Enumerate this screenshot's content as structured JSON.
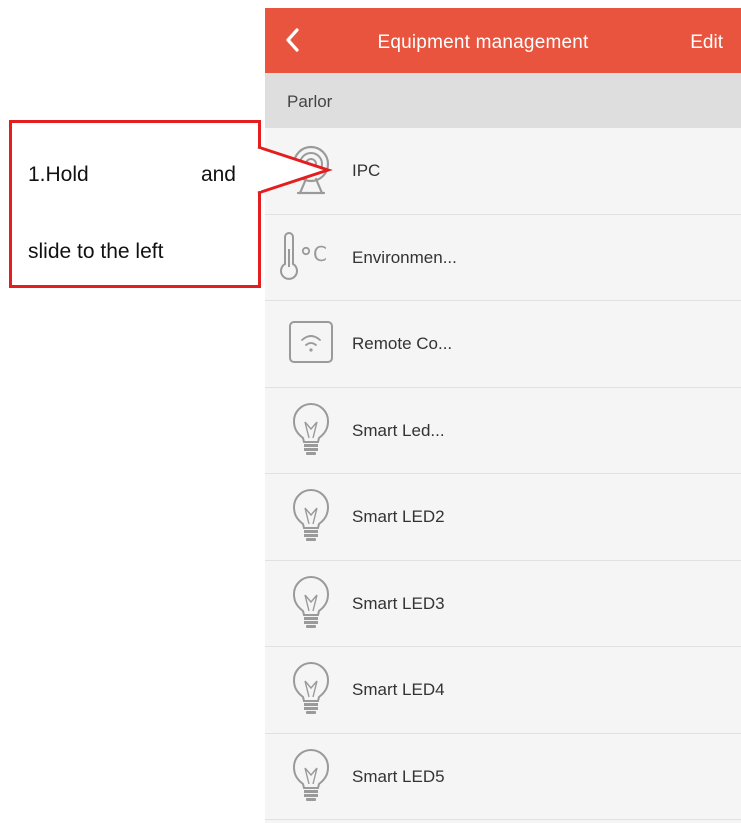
{
  "header": {
    "back_icon": "chevron-left-icon",
    "title": "Equipment management",
    "edit_label": "Edit",
    "color": "#e8543e"
  },
  "section": {
    "label": "Parlor"
  },
  "devices": [
    {
      "label": "IPC",
      "icon": "camera-icon"
    },
    {
      "label": "Environmen...",
      "icon": "thermometer-icon"
    },
    {
      "label": "Remote Co...",
      "icon": "wifi-remote-icon"
    },
    {
      "label": "Smart Led...",
      "icon": "bulb-icon"
    },
    {
      "label": "Smart LED2",
      "icon": "bulb-icon"
    },
    {
      "label": "Smart LED3",
      "icon": "bulb-icon"
    },
    {
      "label": "Smart LED4",
      "icon": "bulb-icon"
    },
    {
      "label": "Smart LED5",
      "icon": "bulb-icon"
    }
  ],
  "callout": {
    "line1_a": "1.Hold",
    "line1_b": "and",
    "line2": "slide to the left",
    "color": "#e41e1e"
  }
}
